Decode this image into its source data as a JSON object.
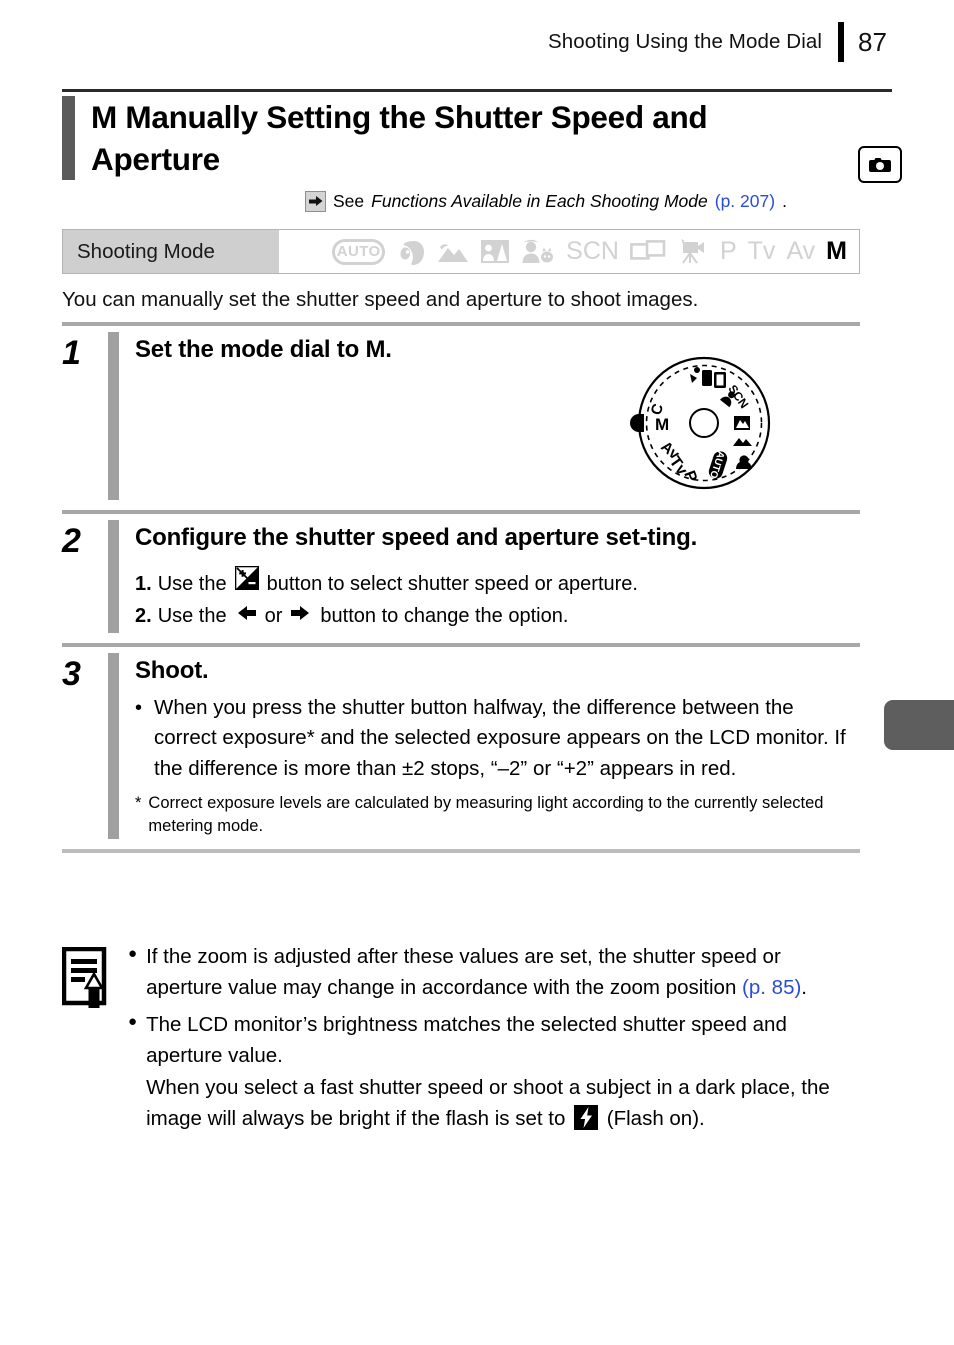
{
  "header": {
    "running_title": "Shooting Using the Mode Dial",
    "page_number": "87"
  },
  "title": {
    "mode_glyph": "M",
    "text": "Manually Setting the Shutter Speed and Aperture",
    "camera_icon": "camera-icon"
  },
  "see_also": {
    "arrow_icon": "arrow-right-icon",
    "lead": "See",
    "reference_title": "Functions Available in Each Shooting Mode",
    "page_ref": "(p. 207)",
    "trailing": "."
  },
  "shooting_mode": {
    "label": "Shooting Mode",
    "modes": [
      {
        "name": "auto",
        "display": "AUTO",
        "type": "oval-text",
        "active": false
      },
      {
        "name": "portrait",
        "display": "portrait-icon",
        "type": "icon",
        "active": false
      },
      {
        "name": "landscape",
        "display": "landscape-icon",
        "type": "icon",
        "active": false
      },
      {
        "name": "night-snapshot",
        "display": "night-snapshot-icon",
        "type": "icon",
        "active": false
      },
      {
        "name": "kids-and-pets",
        "display": "kids-and-pets-icon",
        "type": "icon",
        "active": false
      },
      {
        "name": "scn",
        "display": "SCN",
        "type": "text",
        "active": false
      },
      {
        "name": "stitch-assist",
        "display": "stitch-assist-icon",
        "type": "icon",
        "active": false
      },
      {
        "name": "movie",
        "display": "movie-icon",
        "type": "icon",
        "active": false
      },
      {
        "name": "program",
        "display": "P",
        "type": "text",
        "active": false
      },
      {
        "name": "shutter-priority",
        "display": "Tv",
        "type": "text",
        "active": false
      },
      {
        "name": "aperture-priority",
        "display": "Av",
        "type": "text",
        "active": false
      },
      {
        "name": "manual",
        "display": "M",
        "type": "text",
        "active": true
      }
    ]
  },
  "intro": "You can manually set the shutter speed and aperture to shoot images.",
  "steps": [
    {
      "number": "1",
      "heading_before": "Set the mode dial to ",
      "heading_glyph": "M",
      "heading_after": ".",
      "illustration": "mode-dial-illustration"
    },
    {
      "number": "2",
      "heading": "Configure the shutter speed and aperture set-ting.",
      "substeps": [
        {
          "marker": "1.",
          "before": "Use the",
          "icon": "exposure-compensation-icon",
          "after": "button to select shutter speed or aperture."
        },
        {
          "marker": "2.",
          "before": "Use the",
          "icon_left": "arrow-left-icon",
          "middle": "or",
          "icon_right": "arrow-right-icon",
          "after": "button to change the option."
        }
      ]
    },
    {
      "number": "3",
      "heading": "Shoot.",
      "bullets": [
        "When you press the shutter button halfway, the difference between the correct exposure* and the selected exposure appears on the LCD monitor. If the difference is more than ±2 stops, “–2” or “+2” appears in red."
      ],
      "footnote_marker": "*",
      "footnote": "Correct exposure levels are calculated by measuring light according to the currently selected metering mode."
    }
  ],
  "note_box": {
    "icon": "memo-pencil-icon",
    "items": [
      {
        "text_before": "If the zoom is adjusted after these values are set, the shutter speed or aperture value may change in accordance with the zoom position ",
        "page_ref": "(p. 85)",
        "text_after": "."
      },
      {
        "text_before": "The LCD monitor’s brightness matches the selected shutter speed and aperture value.\nWhen you select a fast shutter speed or shoot a subject in a dark place, the image will always be bright if the flash is set to ",
        "icon": "flash-on-icon",
        "text_after": " (Flash on)."
      }
    ]
  },
  "edge_tab": {
    "name": "chapter-tab"
  },
  "colors": {
    "title_bar": "#5a5a5a",
    "step_bar": "#a0a0a0",
    "mode_label_bg": "#cfcfcf",
    "mode_inactive": "#d2d2d2",
    "page_ref_link": "#2b4cd6",
    "edge_tab": "#5e5e5e"
  }
}
